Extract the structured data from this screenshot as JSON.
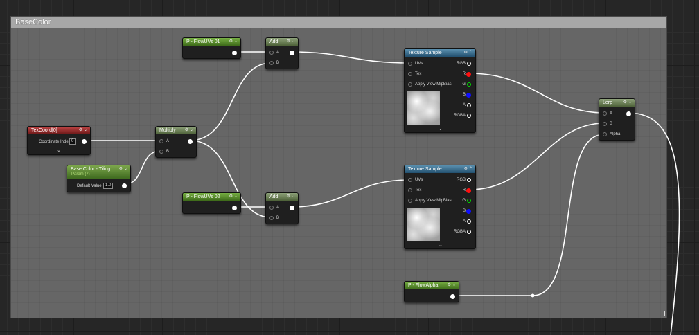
{
  "comment": {
    "title": "BaseColor"
  },
  "nodes": {
    "flow_uvs_01": {
      "title": "P - FlowUVs 01"
    },
    "add_1": {
      "title": "Add",
      "pins": {
        "a": "A",
        "b": "B"
      }
    },
    "tex_sample_1": {
      "title": "Texture Sample",
      "inputs": {
        "uvs": "UVs",
        "tex": "Tex",
        "mip": "Apply View MipBias"
      },
      "outputs": {
        "rgb": "RGB",
        "r": "R",
        "g": "G",
        "b": "B",
        "a": "A",
        "rgba": "RGBA"
      }
    },
    "lerp": {
      "title": "Lerp",
      "pins": {
        "a": "A",
        "b": "B",
        "alpha": "Alpha"
      }
    },
    "texcoord": {
      "title": "TexCoord[0]",
      "coord_label": "Coordinate Index",
      "coord_value": "0"
    },
    "multiply": {
      "title": "Multiply",
      "pins": {
        "a": "A",
        "b": "B"
      }
    },
    "tiling": {
      "title": "Base Color - Tiling",
      "subtitle": "Param (7)",
      "default_label": "Default Value",
      "default_value": "1.0"
    },
    "flow_uvs_02": {
      "title": "P - FlowUVs 02"
    },
    "add_2": {
      "title": "Add",
      "pins": {
        "a": "A",
        "b": "B"
      }
    },
    "tex_sample_2": {
      "title": "Texture Sample",
      "inputs": {
        "uvs": "UVs",
        "tex": "Tex",
        "mip": "Apply View MipBias"
      },
      "outputs": {
        "rgb": "RGB",
        "r": "R",
        "g": "G",
        "b": "B",
        "a": "A",
        "rgba": "RGBA"
      }
    },
    "flow_alpha": {
      "title": "P - FlowAlpha"
    }
  },
  "icons": {
    "gear": "gear-icon",
    "collapse": "chevron-down-icon",
    "expand_preview": "chevron-up-icon"
  },
  "colors": {
    "comment_header": "#a7a7a7",
    "comment_body": "#666666",
    "param_header": "#78b044",
    "math_header": "#8ea27a",
    "texcoord_header": "#c04545",
    "texture_header": "#5a8fae",
    "pin_r": "#ff0000",
    "pin_g": "#00ff00",
    "pin_b": "#0000ff",
    "wire": "#ffffff"
  }
}
